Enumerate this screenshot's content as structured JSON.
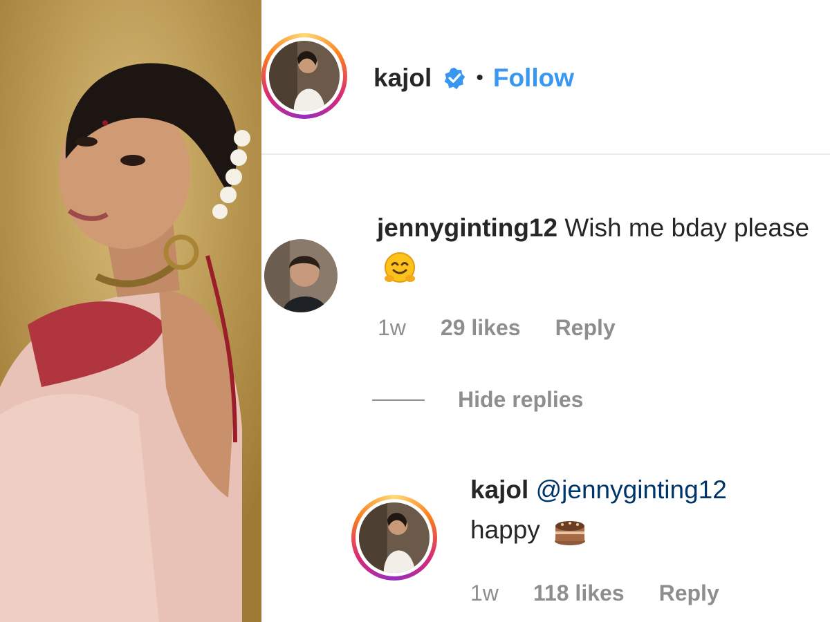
{
  "post": {
    "author": "kajol",
    "follow_label": "Follow",
    "separator": "•"
  },
  "comment": {
    "username": "jennyginting12",
    "text": "Wish me bday please",
    "emoji": "hugging-face",
    "time": "1w",
    "likes": "29 likes",
    "reply_label": "Reply"
  },
  "hide_replies_label": "Hide replies",
  "reply": {
    "username": "kajol",
    "mention": "@jennyginting12",
    "text": "happy",
    "emoji": "cake",
    "time": "1w",
    "likes": "118 likes",
    "reply_label": "Reply"
  },
  "colors": {
    "link_blue": "#3897f0",
    "muted_gray": "#8e8e8e",
    "mention_blue": "#003569",
    "verified_blue": "#3897f0"
  }
}
